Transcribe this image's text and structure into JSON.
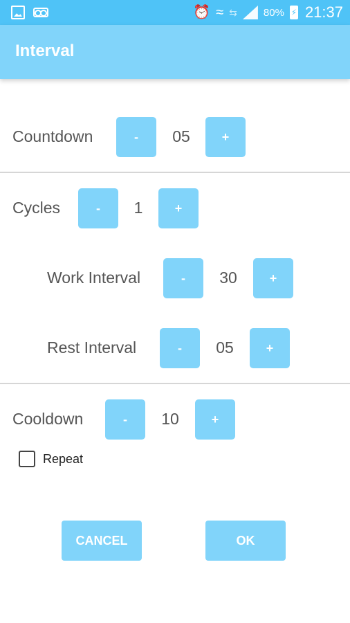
{
  "status_bar": {
    "left_icons": [
      "image-icon",
      "voicemail-icon"
    ],
    "right_icons": [
      "alarm-icon",
      "wifi-icon",
      "network-icon",
      "signal-icon",
      "battery-charging-icon"
    ],
    "battery": "80%",
    "time": "21:37"
  },
  "app_bar": {
    "title": "Interval"
  },
  "countdown": {
    "label": "Countdown",
    "minus": "-",
    "value": "05",
    "plus": "+"
  },
  "cycles": {
    "label": "Cycles",
    "minus": "-",
    "value": "1",
    "plus": "+"
  },
  "work_interval": {
    "label": "Work Interval",
    "minus": "-",
    "value": "30",
    "plus": "+"
  },
  "rest_interval": {
    "label": "Rest Interval",
    "minus": "-",
    "value": "05",
    "plus": "+"
  },
  "cooldown": {
    "label": "Cooldown",
    "minus": "-",
    "value": "10",
    "plus": "+"
  },
  "repeat": {
    "label": "Repeat",
    "checked": false
  },
  "actions": {
    "cancel": "CANCEL",
    "ok": "OK"
  },
  "colors": {
    "status_bar": "#4fc3f7",
    "accent": "#81d4fa",
    "divider": "#d6d6d6",
    "text": "#555555"
  }
}
